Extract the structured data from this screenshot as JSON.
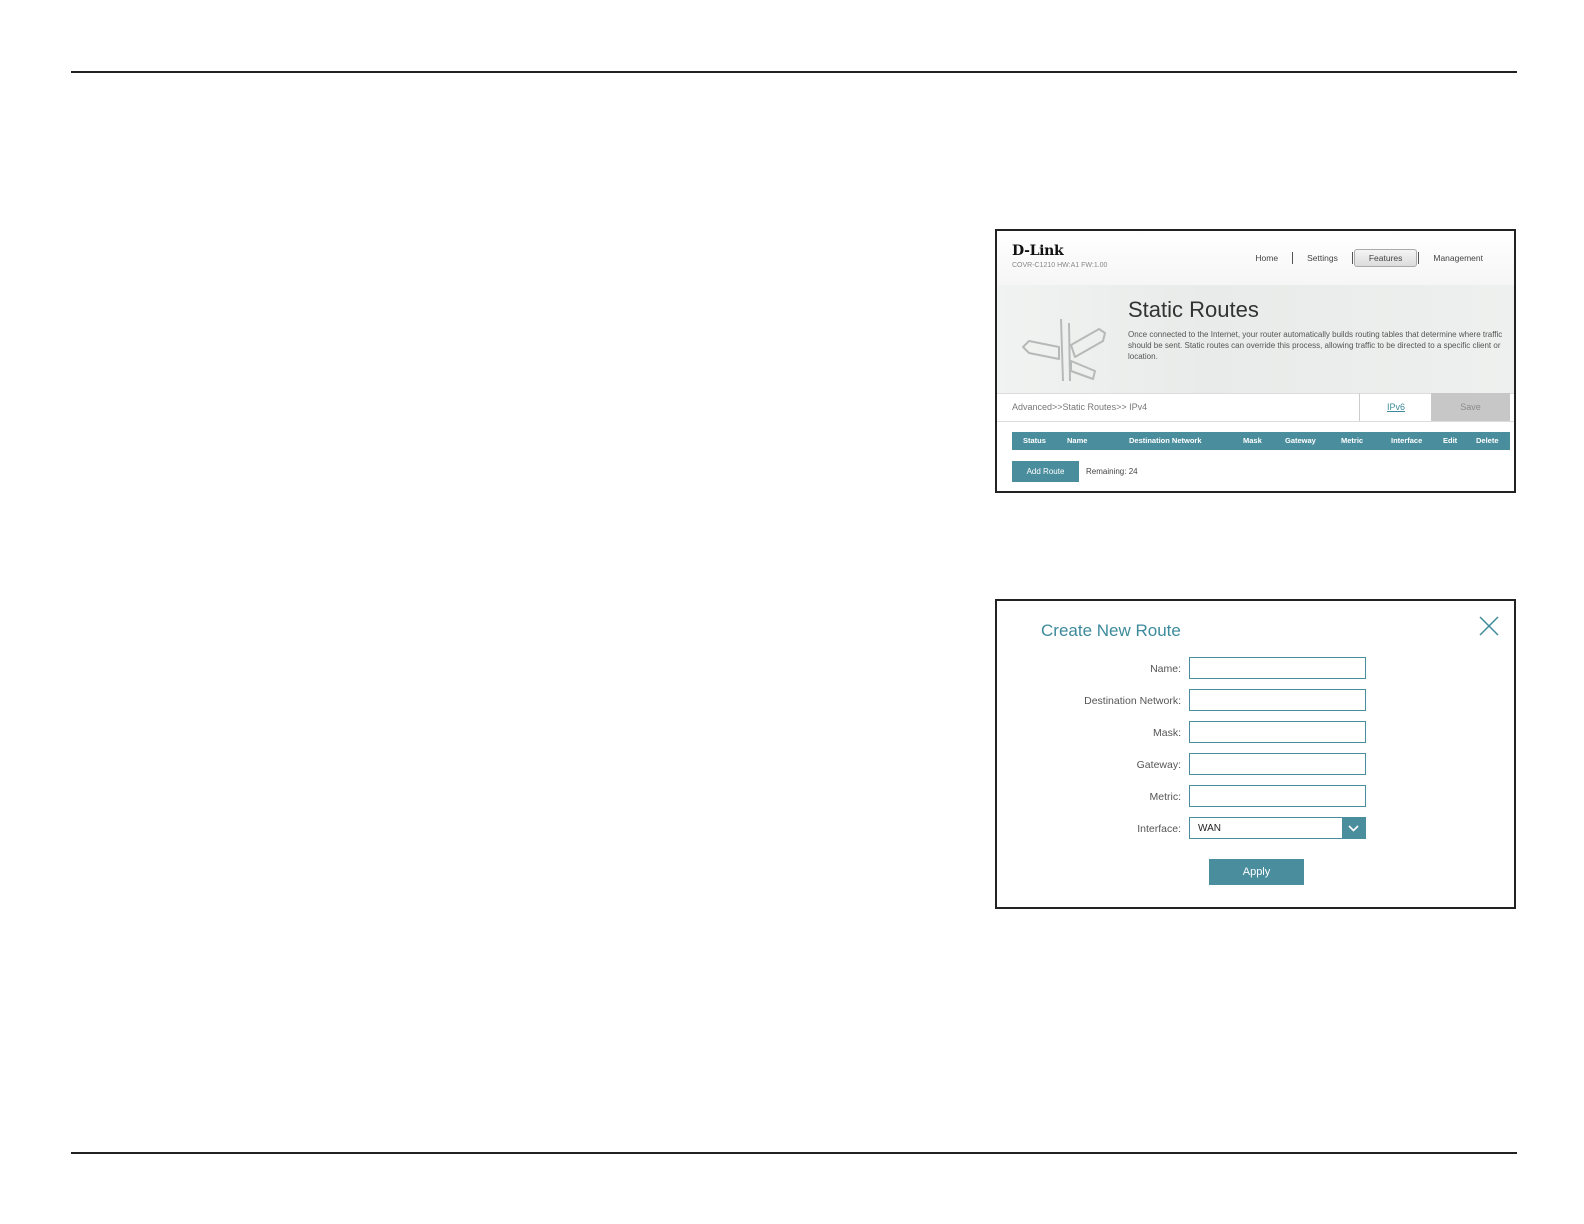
{
  "header": {
    "brand": "D-Link",
    "model_info": "COVR-C1210 HW:A1 FW:1.00",
    "nav": [
      "Home",
      "Settings",
      "Features",
      "Management"
    ],
    "active_nav": "Features"
  },
  "hero": {
    "title": "Static Routes",
    "description": "Once connected to the Internet, your router automatically builds routing tables that determine where traffic should be sent. Static routes can override this process, allowing traffic to be directed to a specific client or location."
  },
  "toolbar": {
    "breadcrumb": "Advanced>>Static Routes>> IPv4",
    "ipv6_tab": "IPv6",
    "save_label": "Save"
  },
  "routes_table": {
    "columns": [
      "Status",
      "Name",
      "Destination Network",
      "Mask",
      "Gateway",
      "Metric",
      "Interface",
      "Edit",
      "Delete"
    ]
  },
  "add_route": {
    "label": "Add Route",
    "remaining": "Remaining: 24"
  },
  "dialog": {
    "title": "Create New Route",
    "fields": {
      "name": {
        "label": "Name:",
        "value": ""
      },
      "destination": {
        "label": "Destination Network:",
        "value": ""
      },
      "mask": {
        "label": "Mask:",
        "value": ""
      },
      "gateway": {
        "label": "Gateway:",
        "value": ""
      },
      "metric": {
        "label": "Metric:",
        "value": ""
      },
      "interface": {
        "label": "Interface:",
        "value": "WAN"
      }
    },
    "apply_label": "Apply"
  },
  "colors": {
    "accent": "#4a8e9e",
    "link": "#3d8a9b",
    "save_disabled": "#c7c7c7"
  }
}
